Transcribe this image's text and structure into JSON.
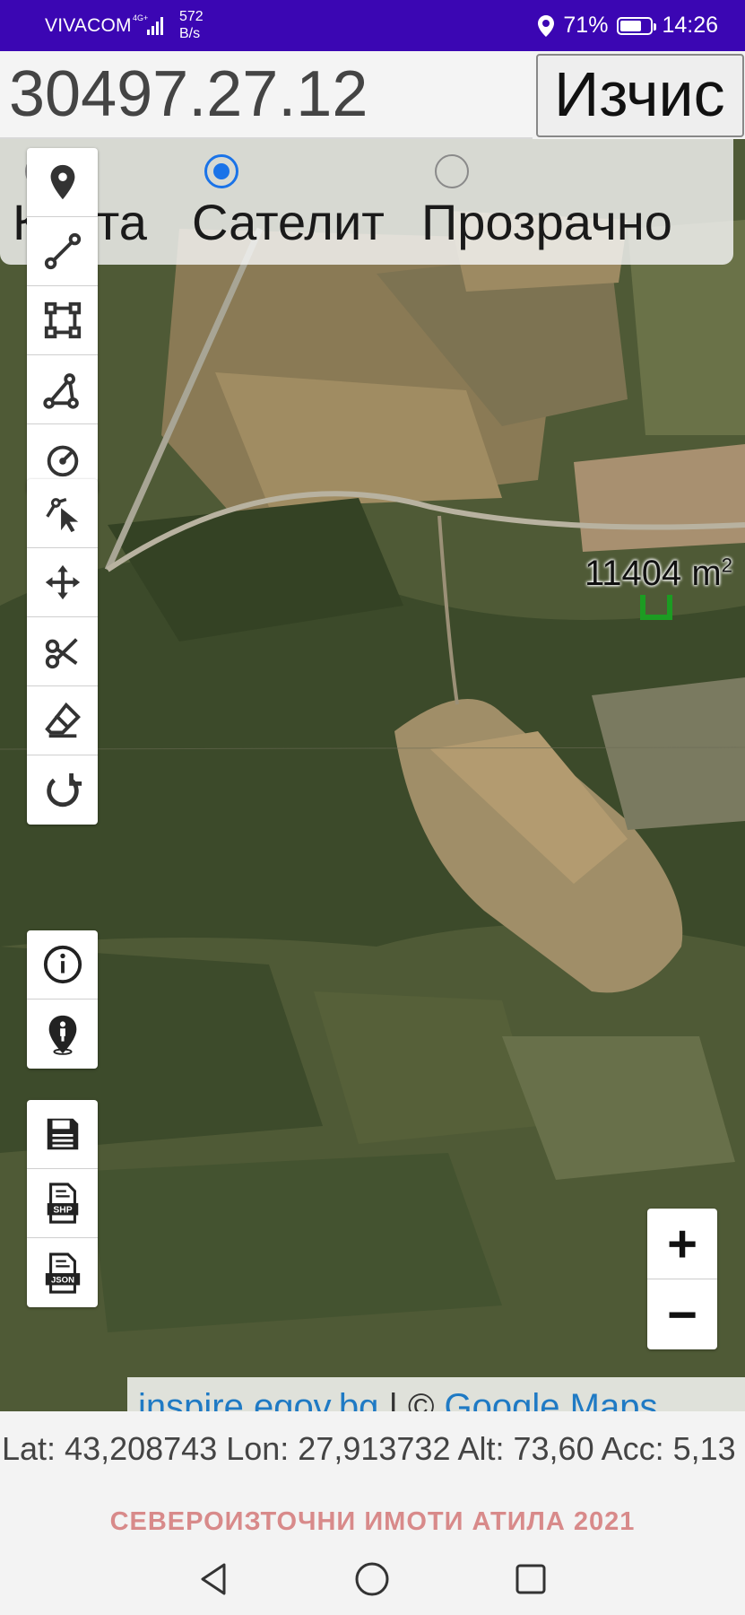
{
  "status_bar": {
    "carrier": "VIVACOM",
    "network": "4G+",
    "speed_value": "572",
    "speed_unit": "B/s",
    "battery": "71%",
    "battery_level": 0.71,
    "time": "14:26"
  },
  "search": {
    "parcel_id": "30497.27.12",
    "calc_button": "Изчис"
  },
  "layers": {
    "options": [
      {
        "label": "Карта",
        "checked": false
      },
      {
        "label": "Сателит",
        "checked": true
      },
      {
        "label": "Прозрачно",
        "checked": false
      }
    ]
  },
  "tools": {
    "group1": [
      "marker-icon",
      "line-icon",
      "polygon-icon",
      "angle-icon",
      "circle-icon"
    ],
    "group2": [
      "pointer-edit-icon",
      "move-icon",
      "scissors-icon",
      "eraser-icon",
      "undo-icon"
    ],
    "group3": [
      "info-icon",
      "person-location-icon"
    ],
    "group4": [
      "save-icon",
      "shp-export-icon",
      "json-export-icon"
    ],
    "shp_label": "SHP",
    "json_label": "JSON"
  },
  "map": {
    "area_value": "11404 m",
    "area_sup": "2",
    "zoom_in": "+",
    "zoom_out": "−",
    "attribution_link1": "inspire.egov.bg",
    "attribution_sep": " | © ",
    "attribution_link2": "Google Maps",
    "parcel_color": "#1c9c22"
  },
  "info": {
    "coords": "Lat: 43,208743 Lon: 27,913732 Alt: 73,60 Acc: 5,13"
  },
  "footer": {
    "title": "СЕВЕРОИЗТОЧНИ ИМОТИ АТИЛА 2021"
  },
  "colors": {
    "status_bar": "#3b06b3",
    "radio_accent": "#1a73e8",
    "footer_title": "#d88a8a"
  }
}
